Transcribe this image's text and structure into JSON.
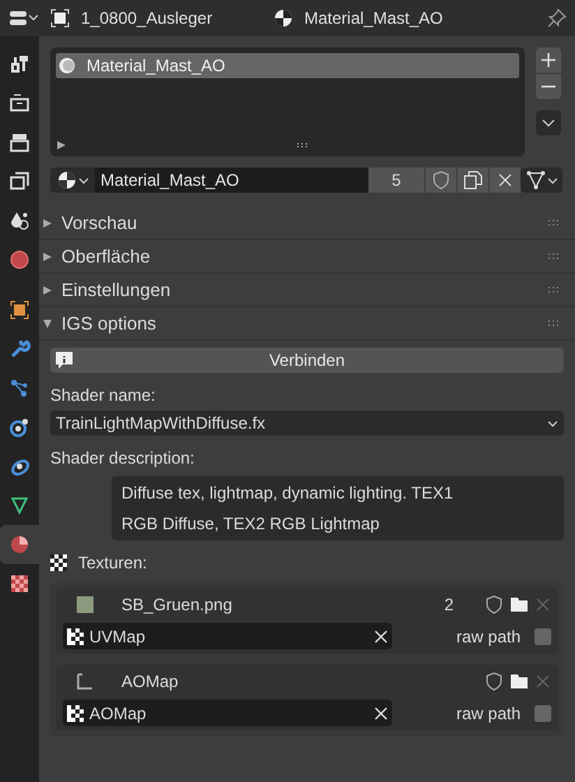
{
  "header": {
    "object_name": "1_0800_Ausleger",
    "material_name": "Material_Mast_AO"
  },
  "sidebar": {
    "tabs": [
      {
        "kind": "tool",
        "selected": false
      },
      {
        "kind": "render",
        "selected": false
      },
      {
        "kind": "output",
        "selected": false
      },
      {
        "kind": "view_layer",
        "selected": false
      },
      {
        "kind": "scene",
        "selected": false
      },
      {
        "kind": "world",
        "selected": false
      },
      {
        "kind": "object",
        "selected": false
      },
      {
        "kind": "modifier",
        "selected": false
      },
      {
        "kind": "particles",
        "selected": false
      },
      {
        "kind": "physics",
        "selected": false
      },
      {
        "kind": "constraints",
        "selected": false
      },
      {
        "kind": "data",
        "selected": false
      },
      {
        "kind": "material",
        "selected": true
      },
      {
        "kind": "texture",
        "selected": false
      }
    ]
  },
  "material_slots": [
    {
      "name": "Material_Mast_AO",
      "selected": true
    }
  ],
  "material_selector": {
    "name": "Material_Mast_AO",
    "users": "5"
  },
  "panels": [
    {
      "title": "Vorschau",
      "expanded": false
    },
    {
      "title": "Oberfläche",
      "expanded": false
    },
    {
      "title": "Einstellungen",
      "expanded": false
    },
    {
      "title": "IGS options",
      "expanded": true
    }
  ],
  "igs": {
    "button": "Verbinden",
    "shader_name_label": "Shader name:",
    "shader_name": "TrainLightMapWithDiffuse.fx",
    "description_label": "Shader description:",
    "description_lines": [
      "Diffuse tex, lightmap, dynamic lighting. TEX1",
      "RGB Diffuse, TEX2 RGB Lightmap"
    ],
    "textures_label": "Texturen:",
    "textures": [
      {
        "kind": "image",
        "name": "SB_Gruen.png",
        "users": "2",
        "uv_map": "UVMap",
        "raw_path_label": "raw path",
        "raw_path": false
      },
      {
        "kind": "empty",
        "name": "AOMap",
        "uv_map": "AOMap",
        "raw_path_label": "raw path",
        "raw_path": false
      }
    ]
  }
}
